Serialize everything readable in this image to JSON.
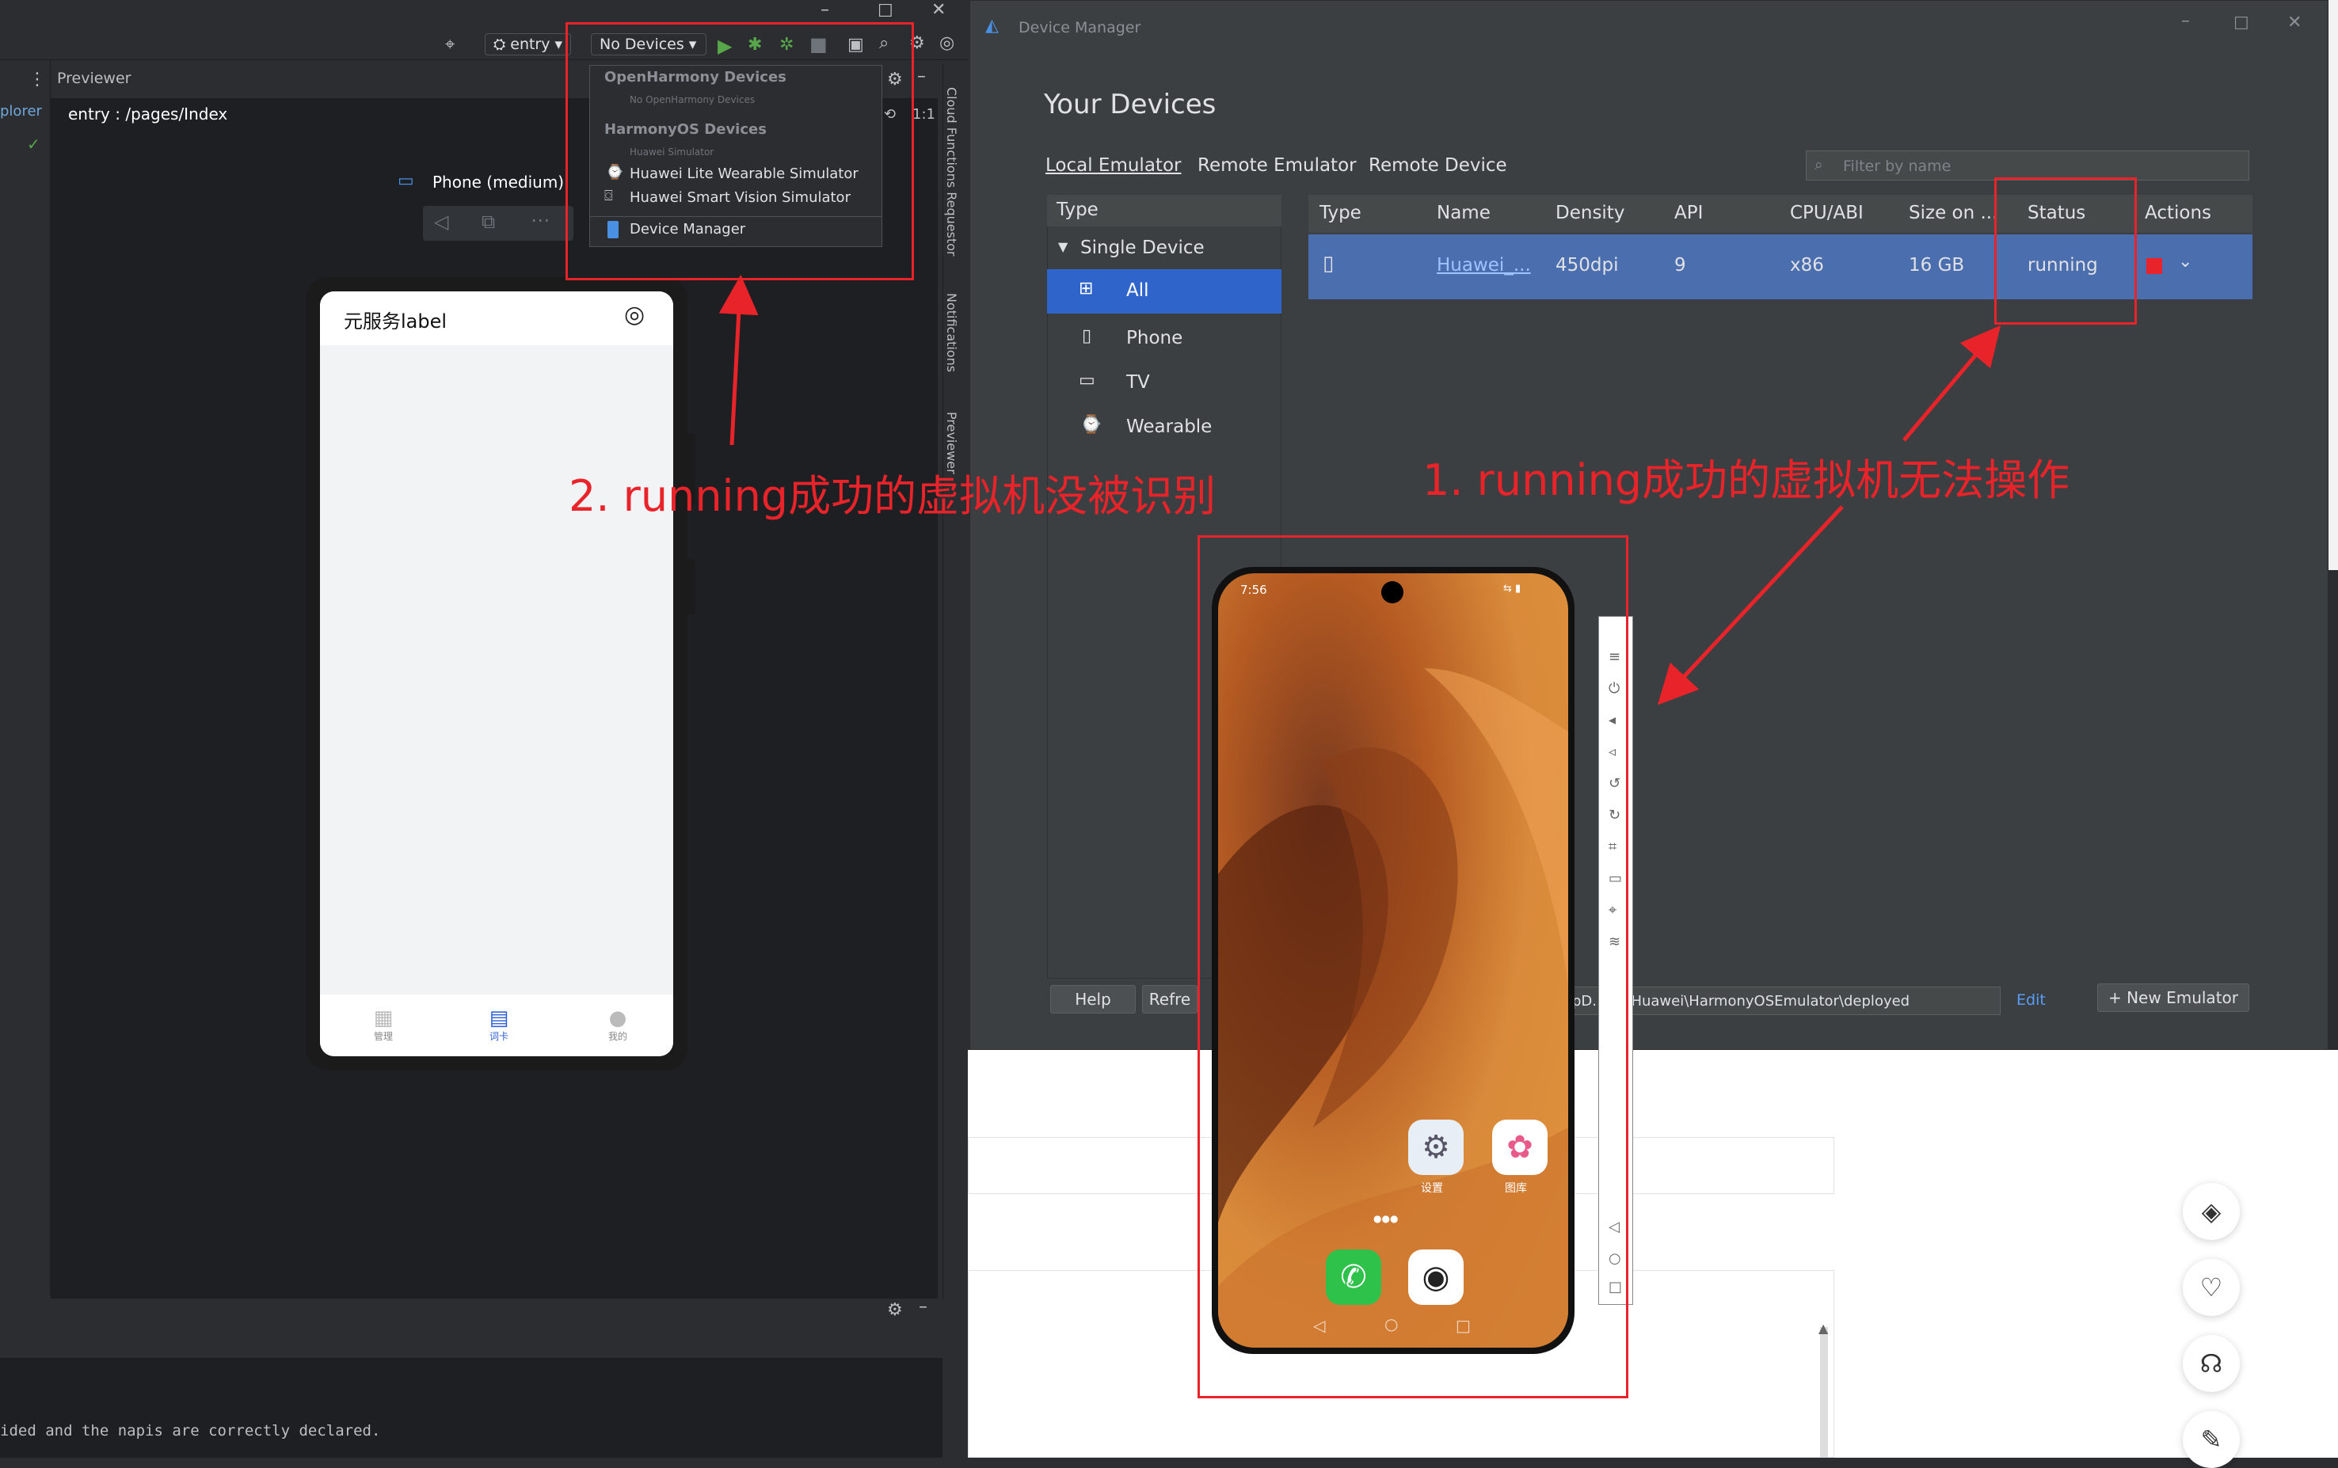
{
  "ide": {
    "entry_label": "entry",
    "devices_combo": "No Devices",
    "previewer_title": "Previewer",
    "explorer_partial": "plorer",
    "path": "entry : /pages/Index",
    "device_name": "Phone (medium)",
    "side_tabs": [
      "Cloud Functions Requestor",
      "Notifications",
      "Previewer"
    ],
    "console_text": "ided and the napis are correctly declared.",
    "ratio_label": "1:1"
  },
  "dropdown": {
    "group1": "OpenHarmony Devices",
    "group1_sub": "No OpenHarmony Devices",
    "group2": "HarmonyOS Devices",
    "group2_sub": "Huawei Simulator",
    "items": [
      "Huawei Lite Wearable Simulator",
      "Huawei Smart Vision Simulator"
    ],
    "device_manager": "Device Manager"
  },
  "phone_preview": {
    "title": "元服务label",
    "tabs": [
      "管理",
      "词卡",
      "我的"
    ]
  },
  "device_manager": {
    "window_title": "Device Manager",
    "heading": "Your Devices",
    "tabs": [
      "Local Emulator",
      "Remote Emulator",
      "Remote Device"
    ],
    "filter_placeholder": "Filter by name",
    "type_header": "Type",
    "single_device": "Single Device",
    "types": [
      "All",
      "Phone",
      "TV",
      "Wearable"
    ],
    "columns": [
      "Type",
      "Name",
      "Density",
      "API",
      "CPU/ABI",
      "Size on ...",
      "Status",
      "Actions"
    ],
    "row": {
      "name": "Huawei_...",
      "density": "450dpi",
      "api": "9",
      "cpu": "x86",
      "size": "16 GB",
      "status": "running"
    },
    "help_btn": "Help",
    "refresh_btn": "Refre",
    "path": "pD...cal\\Huawei\\HarmonyOSEmulator\\deployed",
    "edit": "Edit",
    "new_emulator": "+ New Emulator"
  },
  "emulator": {
    "time": "7:56",
    "apps": [
      "设置",
      "图库"
    ]
  },
  "annotations": {
    "label1": "1. running成功的虚拟机无法操作",
    "label2": "2. running成功的虚拟机没被识别"
  },
  "colors": {
    "annotation_red": "#e8242a",
    "selection_blue": "#4b6eaf",
    "ide_bg": "#2b2d30"
  }
}
